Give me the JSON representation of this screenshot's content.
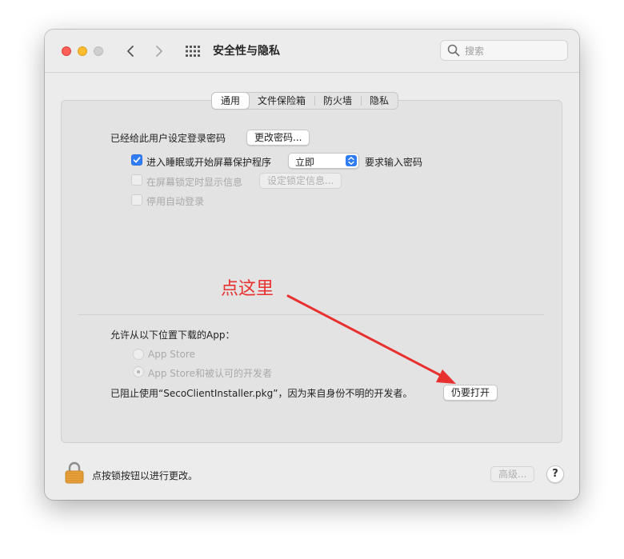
{
  "window": {
    "title": "安全性与隐私",
    "search_placeholder": "搜索"
  },
  "tabs": [
    {
      "label": "通用",
      "active": true
    },
    {
      "label": "文件保险箱",
      "active": false
    },
    {
      "label": "防火墙",
      "active": false
    },
    {
      "label": "隐私",
      "active": false
    }
  ],
  "general": {
    "password_label": "已经给此用户设定登录密码",
    "change_password_button": "更改密码...",
    "require_password": {
      "checked": true,
      "label_prefix": "进入睡眠或开始屏幕保护程序",
      "select_value": "立即",
      "label_suffix": "要求输入密码"
    },
    "lock_message": {
      "checked": false,
      "disabled": true,
      "label": "在屏幕锁定时显示信息",
      "button": "设定锁定信息..."
    },
    "disable_auto_login": {
      "checked": false,
      "disabled": true,
      "label": "停用自动登录"
    }
  },
  "downloads": {
    "heading": "允许从以下位置下载的App：",
    "options": [
      {
        "label": "App Store",
        "selected": false
      },
      {
        "label": "App Store和被认可的开发者",
        "selected": true
      }
    ],
    "blocked_message": "已阻止使用“SecoClientInstaller.pkg”，因为来自身份不明的开发者。",
    "open_anyway_button": "仍要打开"
  },
  "footer": {
    "lock_text": "点按锁按钮以进行更改。",
    "advanced_button": "高级...",
    "help_button": "?"
  },
  "annotation": {
    "text": "点这里",
    "color": "#e8312f"
  },
  "colors": {
    "accent": "#2f7cf6",
    "close": "#fe5f57",
    "minimize": "#febc2e",
    "lock": "#e9a23b"
  }
}
